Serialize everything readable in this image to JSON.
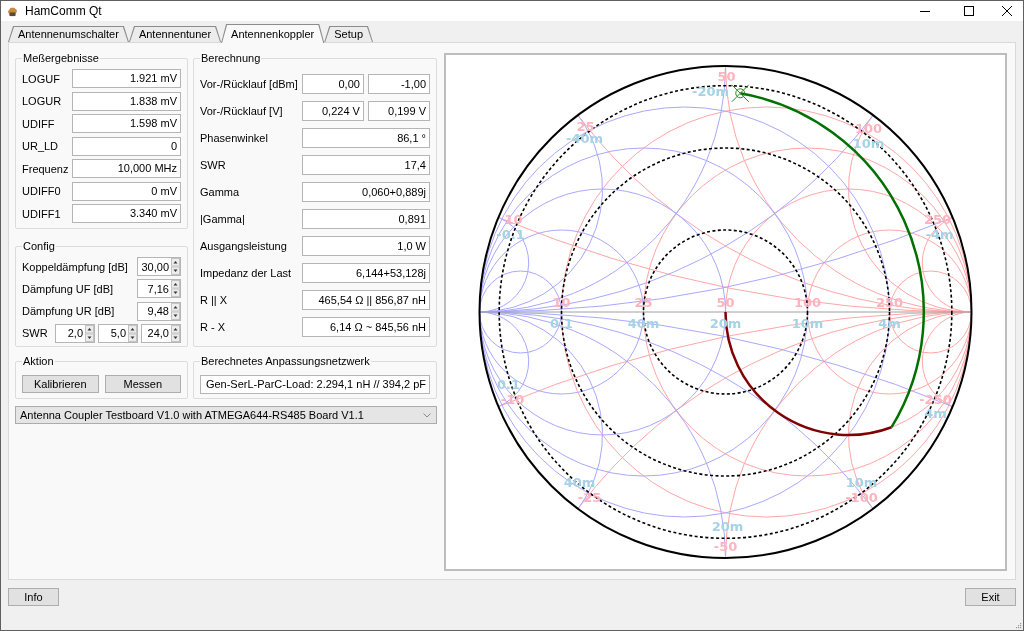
{
  "window": {
    "title": "HamComm Qt"
  },
  "tabs": [
    {
      "label": "Antennenumschalter",
      "selected": false
    },
    {
      "label": "Antennentuner",
      "selected": false
    },
    {
      "label": "Antennenkoppler",
      "selected": true
    },
    {
      "label": "Setup",
      "selected": false
    }
  ],
  "measurements": {
    "title": "Meßergebnisse",
    "rows": [
      {
        "label": "LOGUF",
        "value": "1.921 mV"
      },
      {
        "label": "LOGUR",
        "value": "1.838 mV"
      },
      {
        "label": "UDIFF",
        "value": "1.598 mV"
      },
      {
        "label": "UR_LD",
        "value": "0"
      },
      {
        "label": "Frequenz",
        "value": "10,000 MHz"
      },
      {
        "label": "UDIFF0",
        "value": "0 mV"
      },
      {
        "label": "UDIFF1",
        "value": "3.340 mV"
      }
    ]
  },
  "calculation": {
    "title": "Berechnung",
    "rows": [
      {
        "label": "Vor-/Rücklauf [dBm]",
        "values": [
          "0,00",
          "-1,00"
        ]
      },
      {
        "label": "Vor-/Rücklauf [V]",
        "values": [
          "0,224 V",
          "0,199 V"
        ]
      },
      {
        "label": "Phasenwinkel",
        "values": [
          "86,1 °"
        ]
      },
      {
        "label": "SWR",
        "values": [
          "17,4"
        ]
      },
      {
        "label": "Gamma",
        "values": [
          "0,060+0,889j"
        ]
      },
      {
        "label": "|Gamma|",
        "values": [
          "0,891"
        ]
      },
      {
        "label": "Ausgangsleistung",
        "values": [
          "1,0 W"
        ]
      },
      {
        "label": "Impedanz der Last",
        "values": [
          "6,144+53,128j"
        ]
      },
      {
        "label": "R || X",
        "values": [
          "465,54 Ω || 856,87 nH"
        ]
      },
      {
        "label": "R - X",
        "values": [
          "6,14 Ω ~ 845,56 nH"
        ]
      }
    ]
  },
  "config": {
    "title": "Config",
    "rows": [
      {
        "label": "Koppeldämpfung [dB]",
        "values": [
          "30,00"
        ]
      },
      {
        "label": "Dämpfung UF [dB]",
        "values": [
          "7,16"
        ]
      },
      {
        "label": "Dämpfung UR [dB]",
        "values": [
          "9,48"
        ]
      },
      {
        "label": "SWR",
        "values": [
          "2,0",
          "5,0",
          "24,0"
        ]
      }
    ]
  },
  "action": {
    "title": "Aktion",
    "buttons": [
      "Kalibrieren",
      "Messen"
    ]
  },
  "matching_network": {
    "title": "Berechnetes Anpassungsnetzwerk",
    "value": "Gen-SerL-ParC-Load: 2.294,1 nH // 394,2 pF"
  },
  "board_dropdown": {
    "value": "Antenna Coupler Testboard V1.0 with ATMEGA644-RS485 Board V1.1"
  },
  "smith_chart": {
    "axis_labels": [
      {
        "impedance": "10",
        "admittance": "0.1"
      },
      {
        "impedance": "25",
        "admittance": "40m"
      },
      {
        "impedance": "50",
        "admittance": "20m"
      },
      {
        "impedance": "100",
        "admittance": "10m"
      },
      {
        "impedance": "250",
        "admittance": "4m"
      }
    ],
    "upper_labels": [
      {
        "impedance": "10",
        "admittance": "-0.1"
      },
      {
        "impedance": "25",
        "admittance": "-40m"
      },
      {
        "impedance": "50",
        "admittance": "-20m"
      },
      {
        "impedance": "100",
        "admittance": "10m"
      },
      {
        "impedance": "250",
        "admittance": "-4m"
      }
    ],
    "lower_labels": [
      {
        "impedance": "-10",
        "admittance": "0.1"
      },
      {
        "impedance": "-25",
        "admittance": "40m"
      },
      {
        "impedance": "-50",
        "admittance": "20m"
      },
      {
        "impedance": "-100",
        "admittance": "10m"
      },
      {
        "impedance": "-250",
        "admittance": "4m"
      }
    ]
  },
  "footer_buttons": [
    "Info",
    "Exit"
  ]
}
